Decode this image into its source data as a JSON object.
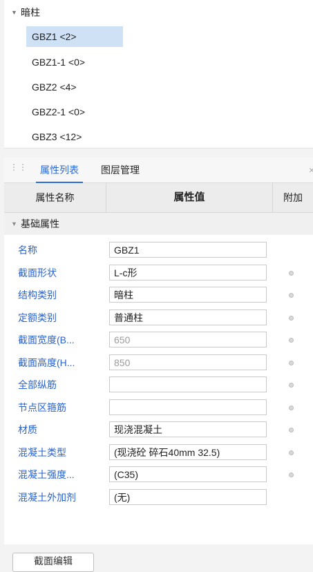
{
  "tree": {
    "root": "暗柱",
    "items": [
      "GBZ1 <2>",
      "GBZ1-1 <0>",
      "GBZ2 <4>",
      "GBZ2-1 <0>",
      "GBZ3 <12>"
    ],
    "selected_index": 0
  },
  "tabs": [
    {
      "label": "属性列表",
      "active": true
    },
    {
      "label": "图层管理",
      "active": false
    }
  ],
  "tab_close": "×",
  "table": {
    "headers": {
      "name": "属性名称",
      "value": "属性值",
      "extra": "附加"
    },
    "group": "基础属性",
    "rows": [
      {
        "label": "名称",
        "value": "GBZ1",
        "dim": false,
        "dot": false
      },
      {
        "label": "截面形状",
        "value": "L-c形",
        "dim": false,
        "dot": true
      },
      {
        "label": "结构类别",
        "value": "暗柱",
        "dim": false,
        "dot": true
      },
      {
        "label": "定额类别",
        "value": "普通柱",
        "dim": false,
        "dot": true
      },
      {
        "label": "截面宽度(B...",
        "value": "650",
        "dim": true,
        "dot": true
      },
      {
        "label": "截面高度(H...",
        "value": "850",
        "dim": true,
        "dot": true
      },
      {
        "label": "全部纵筋",
        "value": "",
        "dim": false,
        "dot": true
      },
      {
        "label": "节点区箍筋",
        "value": "",
        "dim": false,
        "dot": true
      },
      {
        "label": "材质",
        "value": "现浇混凝土",
        "dim": false,
        "dot": true
      },
      {
        "label": "混凝土类型",
        "value": "(现浇砼 碎石40mm 32.5)",
        "dim": false,
        "dot": true
      },
      {
        "label": "混凝土强度...",
        "value": "(C35)",
        "dim": false,
        "dot": true
      },
      {
        "label": "混凝土外加剂",
        "value": "(无)",
        "dim": false,
        "dot": false
      }
    ]
  },
  "bottom_button": "截面编辑",
  "colors": {
    "accent": "#2a6bd8",
    "label_blue": "#2a62cc",
    "selected_bg": "#cfe1f5"
  }
}
